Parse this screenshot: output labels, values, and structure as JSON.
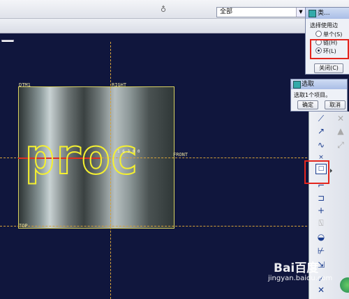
{
  "toolbar": {
    "filter_value": "全部",
    "small_combo": "▾"
  },
  "datums": {
    "dtm1": "DTM1",
    "right": "RIGHT",
    "front": "FRONT",
    "top": "TOP"
  },
  "model": {
    "text": "proc",
    "dim_label": "1 6 3 0 0"
  },
  "type_dialog": {
    "title": "类...",
    "prompt": "选择使用边",
    "options": [
      "单个(S)",
      "链(H)",
      "环(L)"
    ],
    "selected": "环(L)",
    "close_label": "关闭(C)"
  },
  "select_dialog": {
    "title": "选取",
    "message": "选取1个项目。",
    "ok_label": "确定",
    "cancel_label": "取消"
  },
  "right_tools": [
    "line-tool-icon",
    "trim-tool-icon",
    "angle-line-icon",
    "triangle-tool-icon",
    "spline-icon",
    "dimension-icon",
    "close-icon",
    "use-edge-icon",
    "offset-edge-icon",
    "fillet-icon",
    "axis-icon",
    "text-tool-icon",
    "palette-icon",
    "constraint-icon",
    "modify-icon",
    "rotate-icon",
    "done-icon"
  ],
  "watermark": {
    "brand": "Bai百度",
    "url": "jingyan.baidu.com"
  },
  "colors": {
    "canvas_bg": "#10163d",
    "sketch": "#f4f030",
    "datum": "#d6a23a",
    "highlight_box": "#e3261e"
  }
}
